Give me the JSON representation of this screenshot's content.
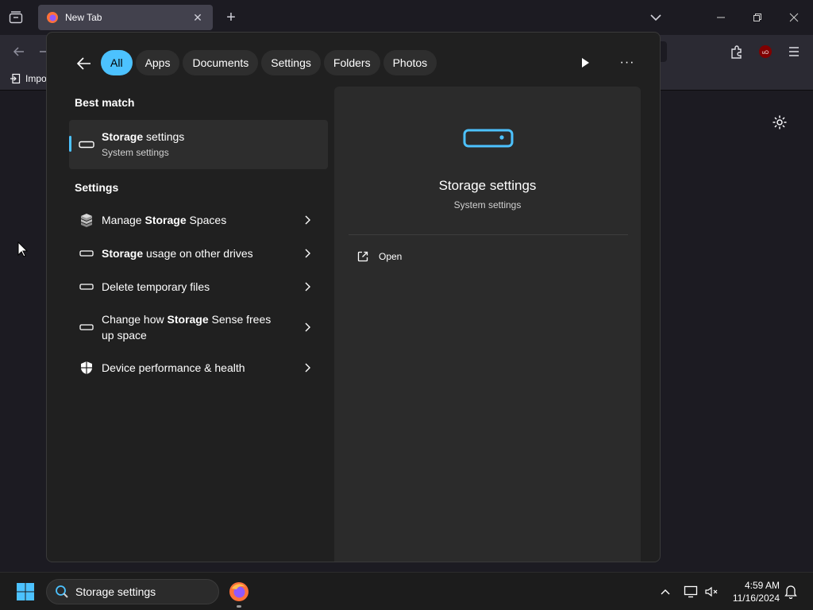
{
  "browser": {
    "tab_title": "New Tab",
    "bookmark_label": "Impo"
  },
  "search_panel": {
    "filters": [
      "All",
      "Apps",
      "Documents",
      "Settings",
      "Folders",
      "Photos"
    ],
    "active_filter": "All",
    "best_match_heading": "Best match",
    "best_match": {
      "title_bold": "Storage",
      "title_rest": " settings",
      "subtitle": "System settings"
    },
    "settings_heading": "Settings",
    "results": [
      {
        "pre": "Manage ",
        "bold": "Storage",
        "post": " Spaces",
        "icon": "storage-spaces-icon"
      },
      {
        "pre": "",
        "bold": "Storage",
        "post": " usage on other drives",
        "icon": "drive-icon"
      },
      {
        "pre": "Delete temporary files",
        "bold": "",
        "post": "",
        "icon": "drive-icon"
      },
      {
        "pre": "Change how ",
        "bold": "Storage",
        "post": " Sense frees up space",
        "icon": "drive-icon"
      },
      {
        "pre": "Device performance & health",
        "bold": "",
        "post": "",
        "icon": "shield-icon"
      }
    ],
    "detail": {
      "title": "Storage settings",
      "subtitle": "System settings",
      "open_label": "Open"
    }
  },
  "taskbar": {
    "search_value": "Storage settings",
    "time": "4:59 AM",
    "date": "11/16/2024"
  },
  "colors": {
    "accent": "#4cc2ff",
    "panel_bg": "#202020",
    "detail_bg": "#2b2b2b"
  }
}
